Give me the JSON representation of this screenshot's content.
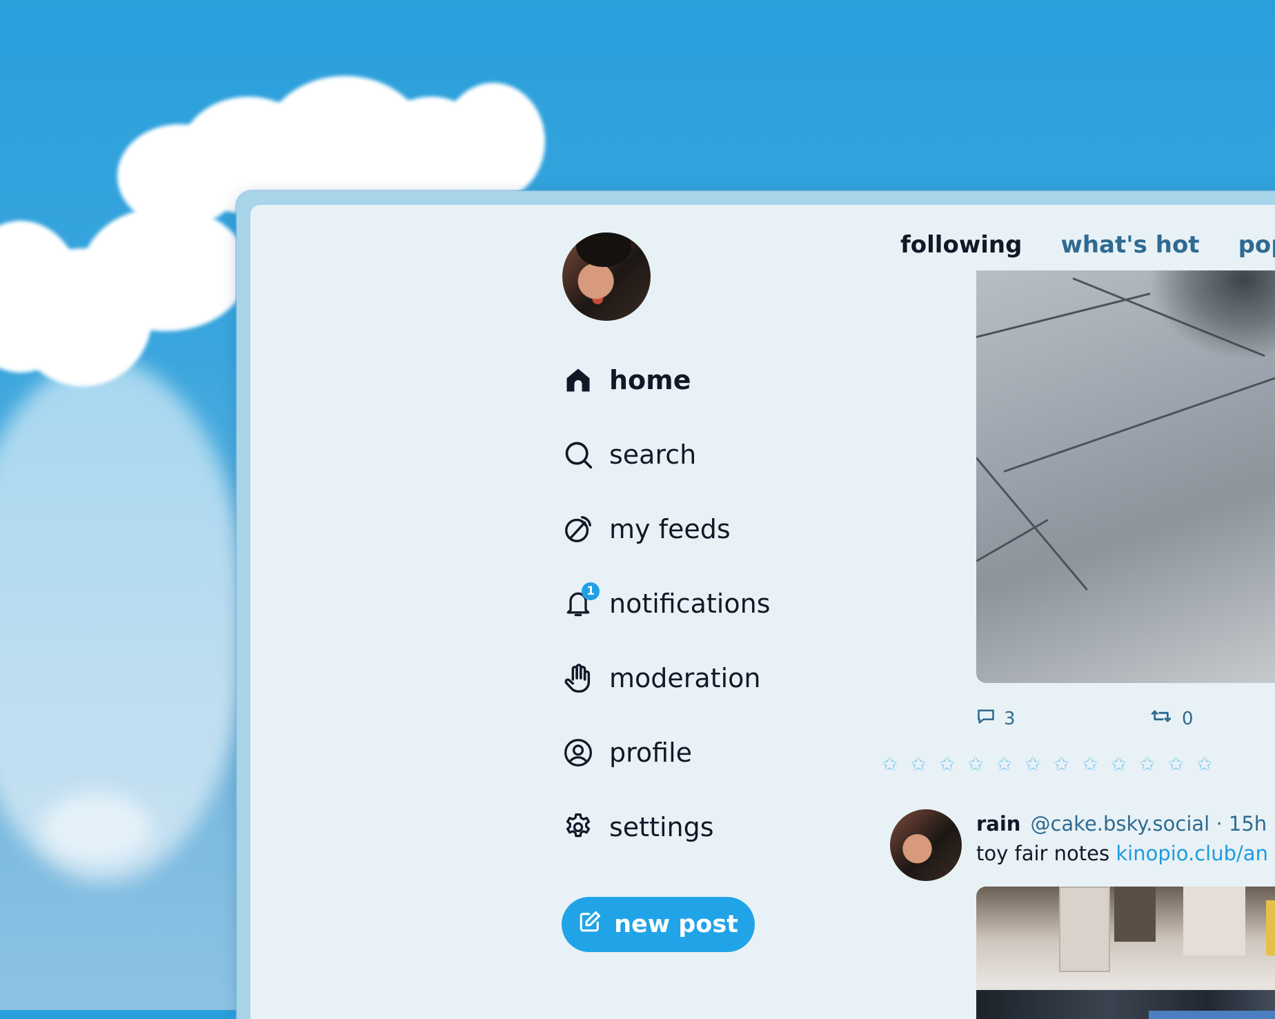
{
  "background": {
    "sky_color": "#2a9fdc",
    "description_icon": "clouds"
  },
  "nav": {
    "items": [
      {
        "label": "home",
        "icon": "home-icon",
        "active": true
      },
      {
        "label": "search",
        "icon": "search-icon"
      },
      {
        "label": "my feeds",
        "icon": "feeds-icon"
      },
      {
        "label": "notifications",
        "icon": "bell-icon",
        "badge": "1"
      },
      {
        "label": "moderation",
        "icon": "hand-icon"
      },
      {
        "label": "profile",
        "icon": "profile-icon"
      },
      {
        "label": "settings",
        "icon": "gear-icon"
      }
    ],
    "new_post_label": "new post"
  },
  "tabs": [
    {
      "label": "following",
      "active": true
    },
    {
      "label": "what's hot"
    },
    {
      "label": "popular"
    }
  ],
  "post1": {
    "replies": "3",
    "reposts": "0"
  },
  "post2": {
    "author": "rain",
    "handle": "@cake.bsky.social",
    "sep": "·",
    "time": "15h",
    "text": "toy fair notes",
    "link": "kinopio.club/an"
  },
  "colors": {
    "accent": "#21a3e8",
    "badge": "#20a0e6",
    "text": "#111827",
    "muted": "#2f6a91",
    "panel": "#e8f2f6"
  }
}
